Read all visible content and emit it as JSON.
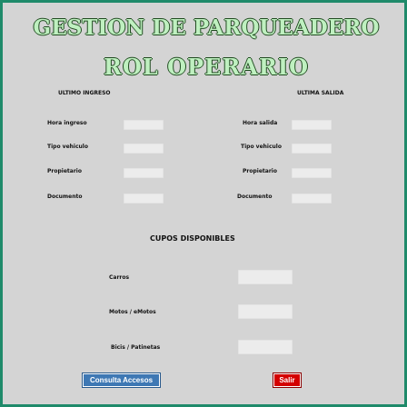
{
  "header": {
    "title": "GESTION DE PARQUEADERO",
    "subtitle": "ROL OPERARIO"
  },
  "last_entry": {
    "heading": "ULTIMO INGRESO",
    "fields": [
      {
        "label": "Hora ingreso",
        "value": ""
      },
      {
        "label": "Tipo vehiculo",
        "value": ""
      },
      {
        "label": "Propietario",
        "value": ""
      },
      {
        "label": "Documento",
        "value": ""
      }
    ]
  },
  "last_exit": {
    "heading": "ULTIMA SALIDA",
    "fields": [
      {
        "label": "Hora salida",
        "value": ""
      },
      {
        "label": "Tipo vehiculo",
        "value": ""
      },
      {
        "label": "Propietario",
        "value": ""
      },
      {
        "label": "Documento",
        "value": ""
      }
    ]
  },
  "availability": {
    "heading": "CUPOS DISPONIBLES",
    "rows": [
      {
        "label": "Carros",
        "value": ""
      },
      {
        "label": "Motos / eMotos",
        "value": ""
      },
      {
        "label": "Bicis / Patinetas",
        "value": ""
      }
    ]
  },
  "actions": {
    "consult_label": "Consulta Accesos",
    "exit_label": "Salir"
  }
}
